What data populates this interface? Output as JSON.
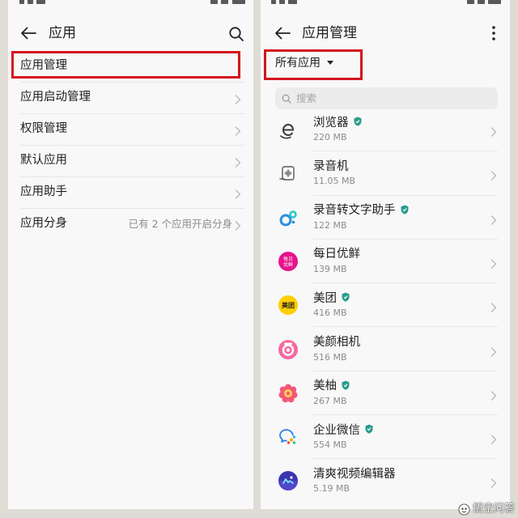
{
  "left_screen": {
    "header": {
      "title": "应用",
      "back_icon": "arrow-left-icon",
      "search_icon": "search-icon"
    },
    "menu": [
      {
        "label": "应用管理",
        "highlighted": true
      },
      {
        "label": "应用启动管理"
      },
      {
        "label": "权限管理"
      },
      {
        "label": "默认应用"
      },
      {
        "label": "应用助手"
      },
      {
        "label": "应用分身",
        "value": "已有 2 个应用开启分身"
      }
    ]
  },
  "right_screen": {
    "header": {
      "title": "应用管理",
      "back_icon": "arrow-left-icon",
      "more_icon": "more-vertical-icon"
    },
    "filter": {
      "label": "所有应用",
      "icon": "caret-down-icon",
      "highlighted": true
    },
    "search": {
      "placeholder": "搜索",
      "icon": "search-icon"
    },
    "apps": [
      {
        "name": "浏览器",
        "size": "220 MB",
        "verified": true,
        "icon": "browser-icon"
      },
      {
        "name": "录音机",
        "size": "11.05 MB",
        "verified": false,
        "icon": "recorder-icon"
      },
      {
        "name": "录音转文字助手",
        "size": "122 MB",
        "verified": true,
        "icon": "speech-to-text-icon"
      },
      {
        "name": "每日优鲜",
        "size": "139 MB",
        "verified": false,
        "icon": "missfresh-logo-icon",
        "logo_text": [
          "每日",
          "优鲜"
        ]
      },
      {
        "name": "美团",
        "size": "416 MB",
        "verified": true,
        "icon": "meituan-logo-icon",
        "logo_text": [
          "美团"
        ]
      },
      {
        "name": "美颜相机",
        "size": "516 MB",
        "verified": false,
        "icon": "beauty-camera-icon"
      },
      {
        "name": "美柚",
        "size": "267 MB",
        "verified": true,
        "icon": "meiyou-icon"
      },
      {
        "name": "企业微信",
        "size": "554 MB",
        "verified": true,
        "icon": "wecom-icon"
      },
      {
        "name": "清爽视频编辑器",
        "size": "5.19 MB",
        "verified": false,
        "icon": "video-editor-icon"
      }
    ]
  },
  "colors": {
    "highlight_box": "#d4141f",
    "verified_badge": "#2b9c8c",
    "text_primary": "#1f1f1f",
    "text_secondary": "#8c8c8c",
    "page_background": "#dedcd4",
    "screen_background": "#f8f8f8"
  },
  "watermark": {
    "text": "悟空问答"
  }
}
